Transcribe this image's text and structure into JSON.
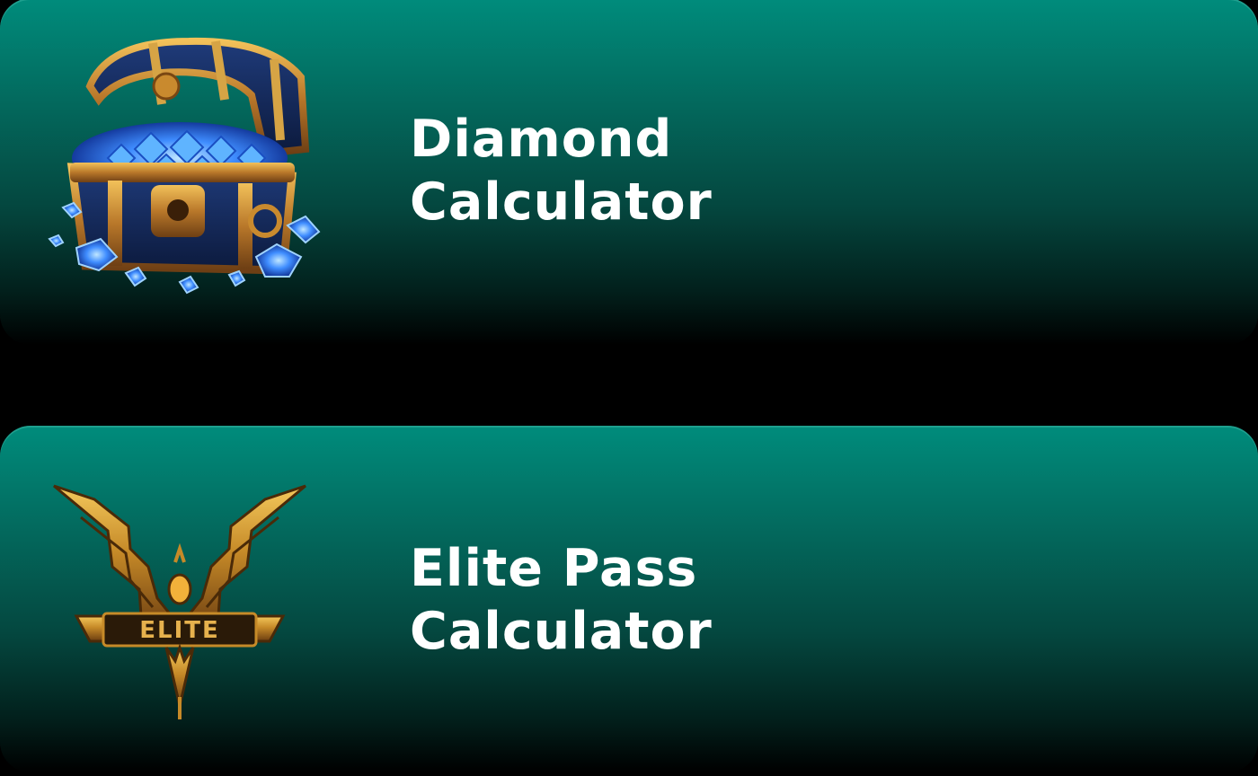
{
  "cards": [
    {
      "title_line1": "Diamond",
      "title_line2": "Calculator",
      "icon": "treasure-chest-diamonds-icon"
    },
    {
      "title_line1": "Elite Pass",
      "title_line2": "Calculator",
      "icon": "elite-winged-emblem-icon",
      "emblem_text": "ELITE"
    }
  ],
  "colors": {
    "card_top": "#008c7c",
    "card_bottom": "#000000",
    "background": "#000000",
    "title_text": "#ffffff",
    "gold": "#c9952e",
    "diamond_blue": "#2f7dff"
  }
}
